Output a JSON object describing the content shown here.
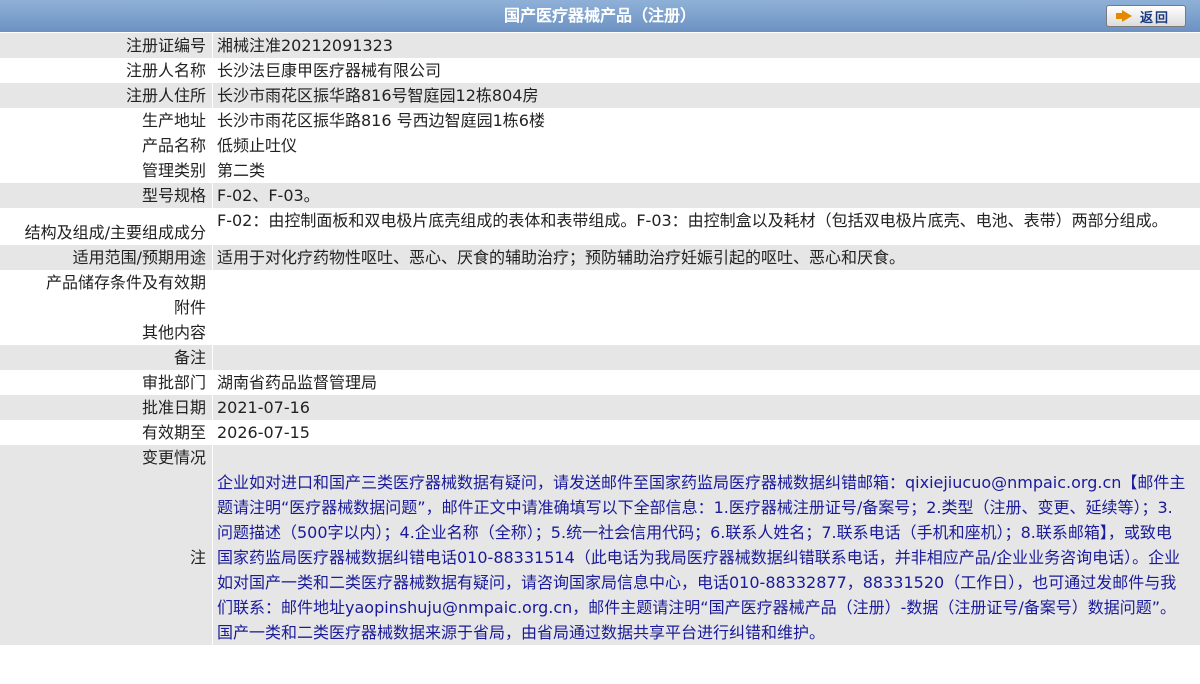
{
  "header": {
    "title": "国产医疗器械产品（注册）",
    "back_label": "返回"
  },
  "fields": {
    "reg_no": {
      "label": "注册证编号",
      "value": "湘械注准20212091323"
    },
    "registrant": {
      "label": "注册人名称",
      "value": "长沙法巨康甲医疗器械有限公司"
    },
    "registrant_addr": {
      "label": "注册人住所",
      "value": "长沙市雨花区振华路816号智庭园12栋804房"
    },
    "production_addr": {
      "label": "生产地址",
      "value": "长沙市雨花区振华路816 号西边智庭园1栋6楼"
    },
    "product_name": {
      "label": "产品名称",
      "value": "低频止吐仪"
    },
    "category": {
      "label": "管理类别",
      "value": "第二类"
    },
    "model": {
      "label": "型号规格",
      "value": "F-02、F-03。"
    },
    "structure": {
      "label": "结构及组成/主要组成成分",
      "value": "F-02：由控制面板和双电极片底壳组成的表体和表带组成。F-03：由控制盒以及耗材（包括双电极片底壳、电池、表带）两部分组成。"
    },
    "scope": {
      "label": "适用范围/预期用途",
      "value": "适用于对化疗药物性呕吐、恶心、厌食的辅助治疗；预防辅助治疗妊娠引起的呕吐、恶心和厌食。"
    },
    "storage": {
      "label": "产品储存条件及有效期",
      "value": ""
    },
    "attachment": {
      "label": "附件",
      "value": ""
    },
    "other": {
      "label": "其他内容",
      "value": ""
    },
    "remark": {
      "label": "备注",
      "value": ""
    },
    "authority": {
      "label": "审批部门",
      "value": "湖南省药品监督管理局"
    },
    "approval_date": {
      "label": "批准日期",
      "value": "2021-07-16"
    },
    "valid_until": {
      "label": "有效期至",
      "value": "2026-07-15"
    },
    "changes": {
      "label": "变更情况",
      "value": ""
    },
    "note": {
      "label": "注",
      "value": "企业如对进口和国产三类医疗器械数据有疑问，请发送邮件至国家药监局医疗器械数据纠错邮箱：qixiejiucuo@nmpaic.org.cn【邮件主题请注明“医疗器械数据问题”，邮件正文中请准确填写以下全部信息：1.医疗器械注册证号/备案号；2.类型（注册、变更、延续等）；3.问题描述（500字以内）；4.企业名称（全称）；5.统一社会信用代码；6.联系人姓名；7.联系电话（手机和座机）；8.联系邮箱】，或致电国家药监局医疗器械数据纠错电话010-88331514（此电话为我局医疗器械数据纠错联系电话，并非相应产品/企业业务咨询电话）。企业如对国产一类和二类医疗器械数据有疑问，请咨询国家局信息中心，电话010-88332877，88331520（工作日），也可通过发邮件与我们联系：邮件地址yaopinshuju@nmpaic.org.cn，邮件主题请注明“国产医疗器械产品（注册）-数据（注册证号/备案号）数据问题”。国产一类和二类医疗器械数据来源于省局，由省局通过数据共享平台进行纠错和维护。"
    }
  },
  "colors": {
    "header_bg": "#7a9ccb",
    "row_alt_bg": "#e6e6e6",
    "note_text": "#1a1a9a"
  },
  "icons": {
    "back": "arrow-right-icon"
  }
}
